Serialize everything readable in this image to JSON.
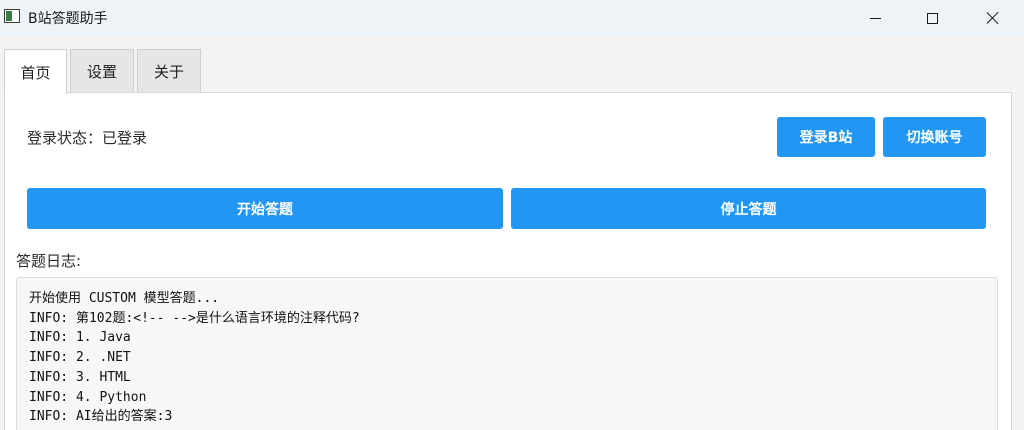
{
  "window": {
    "title": "B站答题助手",
    "icon": "app-window-icon",
    "controls": {
      "minimize": "minimize-icon",
      "maximize": "maximize-icon",
      "close": "close-icon"
    }
  },
  "tabs": [
    {
      "label": "首页",
      "active": true
    },
    {
      "label": "设置",
      "active": false
    },
    {
      "label": "关于",
      "active": false
    }
  ],
  "home": {
    "login_status": "登录状态：已登录",
    "login_button": "登录B站",
    "switch_account_button": "切换账号",
    "start_button": "开始答题",
    "stop_button": "停止答题",
    "log_label": "答题日志:",
    "log_lines": [
      "开始使用 CUSTOM 模型答题...",
      "INFO: 第102题:<!-- -->是什么语言环境的注释代码?",
      "INFO: 1. Java",
      "INFO: 2. .NET",
      "INFO: 3. HTML",
      "INFO: 4. Python",
      "INFO: AI给出的答案:3"
    ]
  },
  "colors": {
    "accent": "#2196f3",
    "titlebar": "#eef3f8",
    "background": "#f3f3f3"
  }
}
